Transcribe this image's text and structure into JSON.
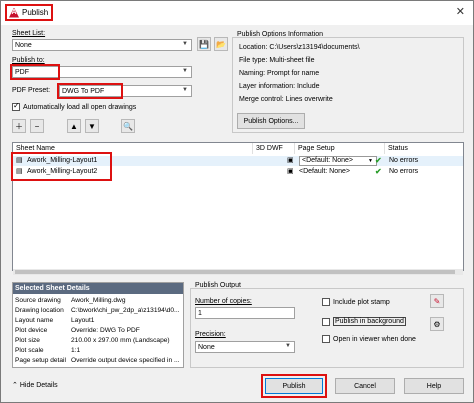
{
  "window": {
    "title": "Publish",
    "close": "✕"
  },
  "sheet_list": {
    "label": "Sheet List:",
    "value": "None"
  },
  "publish_to": {
    "label": "Publish to:",
    "value": "PDF"
  },
  "pdf_preset": {
    "label": "PDF Preset:",
    "value": "DWG To PDF"
  },
  "auto_load": {
    "label": "Automatically load all open drawings",
    "checked": true
  },
  "publish_info": {
    "title": "Publish Options Information",
    "lines": [
      "Location: C:\\Users\\z13194\\documents\\",
      "File type: Multi-sheet file",
      "Naming: Prompt for name",
      "Layer information: Include",
      "Merge control: Lines overwrite"
    ],
    "options_button": "Publish Options..."
  },
  "table": {
    "headers": [
      "Sheet Name",
      "3D DWF",
      "Page Setup",
      "Status"
    ],
    "rows": [
      {
        "name": "Awork_Milling-Layout1",
        "page_setup": "<Default: None>",
        "status": "No errors"
      },
      {
        "name": "Awork_Milling-Layout2",
        "page_setup": "<Default: None>",
        "status": "No errors"
      }
    ]
  },
  "details": {
    "title": "Selected Sheet Details",
    "rows": [
      {
        "key": "Source drawing",
        "value": "Awork_Milling.dwg"
      },
      {
        "key": "Drawing location",
        "value": "C:\\bwork\\chi_pw_2dp_a\\z13194\\d0..."
      },
      {
        "key": "Layout name",
        "value": "Layout1"
      },
      {
        "key": "Plot device",
        "value": "Override: DWG To PDF"
      },
      {
        "key": "Plot size",
        "value": "210.00 x 297.00 mm (Landscape)"
      },
      {
        "key": "Plot scale",
        "value": "1:1"
      },
      {
        "key": "Page setup detail",
        "value": "Override output device specified in ..."
      }
    ]
  },
  "publish_output": {
    "title": "Publish Output",
    "copies_label": "Number of copies:",
    "copies_value": "1",
    "precision_label": "Precision:",
    "precision_value": "None",
    "include_stamp": "Include plot stamp",
    "background": "Publish in background",
    "open_viewer": "Open in viewer when done"
  },
  "footer": {
    "hide_details": "Hide Details",
    "publish": "Publish",
    "cancel": "Cancel",
    "help": "Help"
  },
  "colors": {
    "highlight": "#dd1111",
    "details_header": "#5b6a80"
  }
}
